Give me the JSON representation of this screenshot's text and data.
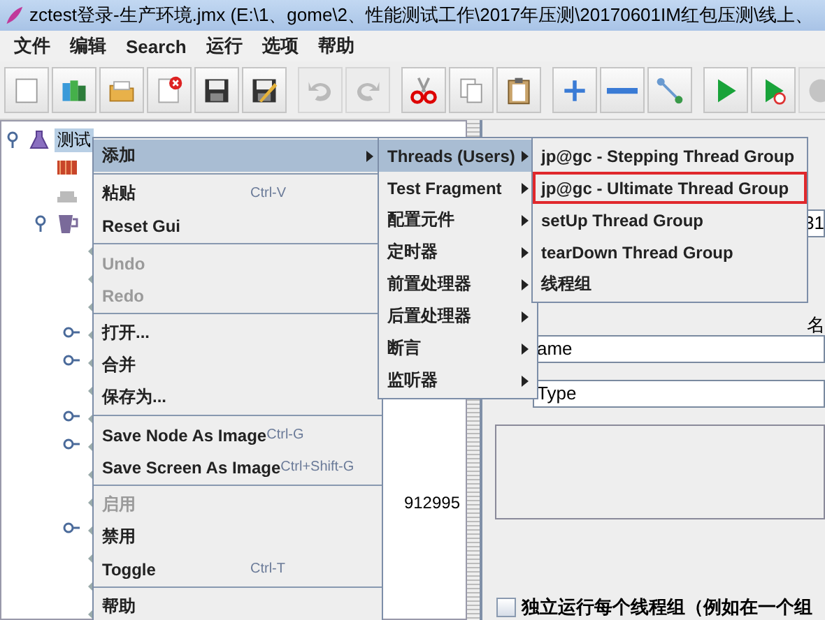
{
  "window": {
    "title": "zctest登录-生产环境.jmx (E:\\1、gome\\2、性能测试工作\\2017年压测\\20170601IM红包压测\\线上、"
  },
  "menubar": [
    "文件",
    "编辑",
    "Search",
    "运行",
    "选项",
    "帮助"
  ],
  "toolbar": [
    [
      {
        "kind": "new",
        "disabled": false
      },
      {
        "kind": "templates",
        "disabled": false
      },
      {
        "kind": "open",
        "disabled": false
      },
      {
        "kind": "close",
        "disabled": false
      },
      {
        "kind": "save",
        "disabled": false
      },
      {
        "kind": "save-as",
        "disabled": false
      }
    ],
    [
      {
        "kind": "undo",
        "disabled": true
      },
      {
        "kind": "redo",
        "disabled": true
      }
    ],
    [
      {
        "kind": "cut",
        "disabled": false
      },
      {
        "kind": "copy",
        "disabled": false
      },
      {
        "kind": "paste",
        "disabled": false
      }
    ],
    [
      {
        "kind": "expand",
        "disabled": false
      },
      {
        "kind": "collapse",
        "disabled": false
      },
      {
        "kind": "toggle",
        "disabled": false
      }
    ],
    [
      {
        "kind": "start",
        "disabled": false
      },
      {
        "kind": "start-no-pause",
        "disabled": false
      },
      {
        "kind": "stop",
        "disabled": true
      }
    ]
  ],
  "tree": {
    "kind": "plan",
    "label": "测试",
    "selected": true,
    "expanded": true,
    "children": [
      {
        "kind": "thread-group"
      },
      {
        "kind": "workbench"
      },
      {
        "kind": "cup",
        "expanded": true,
        "children": [
          {
            "kind": "sampler"
          },
          {
            "kind": "sampler"
          },
          {
            "kind": "sampler"
          },
          {
            "kind": "sampler",
            "expanded": false
          },
          {
            "kind": "sampler",
            "expanded": false
          },
          {
            "kind": "sampler"
          },
          {
            "kind": "sampler",
            "expanded": false
          },
          {
            "kind": "sampler",
            "expanded": false
          },
          {
            "kind": "sampler"
          },
          {
            "kind": "sampler",
            "label": "912995"
          },
          {
            "kind": "sampler",
            "expanded": false
          },
          {
            "kind": "sampler"
          },
          {
            "kind": "sampler"
          },
          {
            "kind": "sampler"
          }
        ]
      }
    ]
  },
  "context_menu": [
    {
      "kind": "item",
      "label": "添加",
      "submenu": true,
      "disabled": false,
      "selected": true
    },
    {
      "kind": "separator"
    },
    {
      "kind": "item",
      "label": "粘贴",
      "shortcut": "Ctrl-V",
      "disabled": false,
      "selected": false
    },
    {
      "kind": "item",
      "label": "Reset Gui",
      "disabled": false,
      "selected": false
    },
    {
      "kind": "separator"
    },
    {
      "kind": "item",
      "label": "Undo",
      "disabled": true,
      "selected": false
    },
    {
      "kind": "item",
      "label": "Redo",
      "disabled": true,
      "selected": false
    },
    {
      "kind": "separator"
    },
    {
      "kind": "item",
      "label": "打开...",
      "disabled": false,
      "selected": false
    },
    {
      "kind": "item",
      "label": "合并",
      "disabled": false,
      "selected": false
    },
    {
      "kind": "item",
      "label": "保存为...",
      "disabled": false,
      "selected": false
    },
    {
      "kind": "separator"
    },
    {
      "kind": "item",
      "label": "Save Node As Image",
      "shortcut": "Ctrl-G",
      "disabled": false,
      "selected": false
    },
    {
      "kind": "item",
      "label": "Save Screen As Image",
      "shortcut": "Ctrl+Shift-G",
      "disabled": false,
      "selected": false
    },
    {
      "kind": "separator"
    },
    {
      "kind": "item",
      "label": "启用",
      "disabled": true,
      "selected": false
    },
    {
      "kind": "item",
      "label": "禁用",
      "disabled": false,
      "selected": false
    },
    {
      "kind": "item",
      "label": "Toggle",
      "shortcut": "Ctrl-T",
      "disabled": false,
      "selected": false
    },
    {
      "kind": "separator"
    },
    {
      "kind": "item",
      "label": "帮助",
      "disabled": false,
      "selected": false
    }
  ],
  "add_submenu": [
    {
      "label": "Threads (Users)",
      "submenu": true,
      "selected": true
    },
    {
      "label": "Test Fragment",
      "submenu": true,
      "selected": false
    },
    {
      "label": "配置元件",
      "submenu": true,
      "selected": false
    },
    {
      "label": "定时器",
      "submenu": true,
      "selected": false
    },
    {
      "label": "前置处理器",
      "submenu": true,
      "selected": false
    },
    {
      "label": "后置处理器",
      "submenu": true,
      "selected": false
    },
    {
      "label": "断言",
      "submenu": true,
      "selected": false
    },
    {
      "label": "监听器",
      "submenu": true,
      "selected": false
    }
  ],
  "threads_submenu": [
    {
      "label": "jp@gc - Stepping Thread Group",
      "outlined": false
    },
    {
      "label": "jp@gc - Ultimate Thread Group",
      "outlined": true
    },
    {
      "label": "setUp Thread Group",
      "outlined": false
    },
    {
      "label": "tearDown Thread Group",
      "outlined": false
    },
    {
      "label": "线程组",
      "outlined": false
    }
  ],
  "right_panel": {
    "field_value": "31",
    "table_header": "名",
    "fields": [
      "ame",
      "Type"
    ],
    "checkbox": {
      "label": "独立运行每个线程组（例如在一个组",
      "checked": false
    }
  }
}
